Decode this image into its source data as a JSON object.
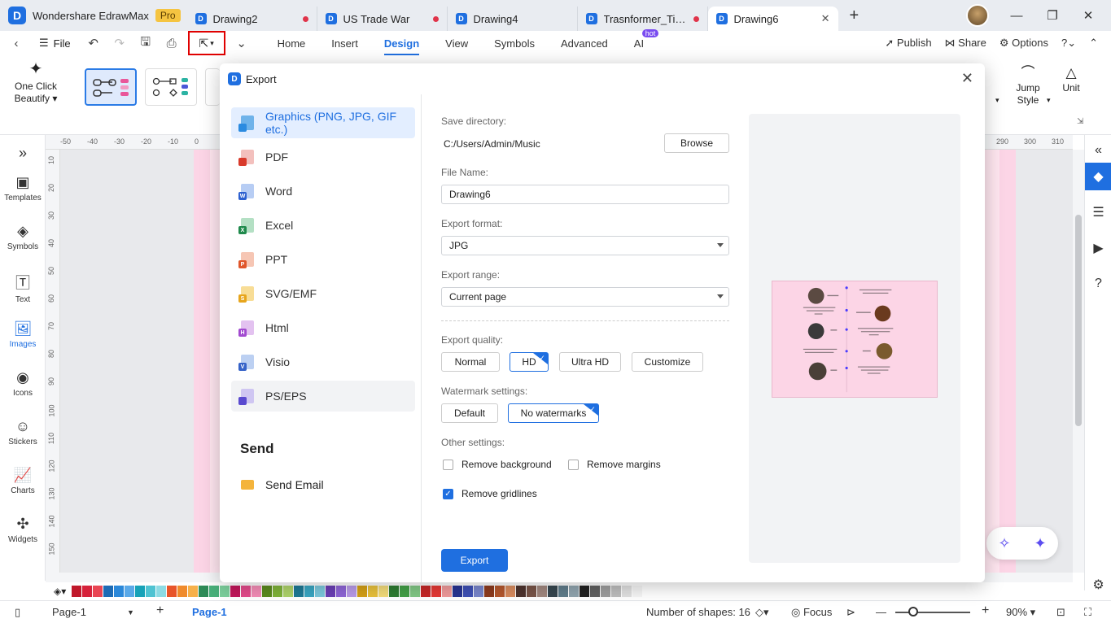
{
  "titlebar": {
    "app_name": "Wondershare EdrawMax",
    "pro_badge": "Pro",
    "tabs": [
      {
        "label": "Drawing2",
        "unsaved": true
      },
      {
        "label": "US Trade War",
        "unsaved": true
      },
      {
        "label": "Drawing4",
        "unsaved": false
      },
      {
        "label": "Trasnformer_Time...",
        "unsaved": true
      },
      {
        "label": "Drawing6",
        "active": true
      }
    ]
  },
  "menubar": {
    "file_label": "File",
    "tabs": [
      "Home",
      "Insert",
      "Design",
      "View",
      "Symbols",
      "Advanced",
      "AI"
    ],
    "active_tab": "Design",
    "ai_badge": "hot",
    "publish": "Publish",
    "share": "Share",
    "options": "Options"
  },
  "ribbon": {
    "one_click_beautify": "One Click Beautify",
    "jump_style": "Jump Style",
    "unit": "Unit"
  },
  "leftbar": {
    "items": [
      "Templates",
      "Symbols",
      "Text",
      "Images",
      "Icons",
      "Stickers",
      "Charts",
      "Widgets"
    ],
    "active": "Images"
  },
  "rulers": {
    "h_ticks": [
      "-50",
      "-40",
      "-30",
      "-20",
      "-10",
      "0",
      "290",
      "300",
      "310"
    ],
    "v_ticks": [
      "10",
      "20",
      "30",
      "40",
      "50",
      "60",
      "70",
      "80",
      "90",
      "100",
      "110",
      "120",
      "130",
      "140",
      "150"
    ]
  },
  "dialog": {
    "title": "Export",
    "formats": [
      "Graphics (PNG, JPG, GIF etc.)",
      "PDF",
      "Word",
      "Excel",
      "PPT",
      "SVG/EMF",
      "Html",
      "Visio",
      "PS/EPS"
    ],
    "active_format": "Graphics (PNG, JPG, GIF etc.)",
    "send_title": "Send",
    "send_email": "Send Email",
    "save_directory_label": "Save directory:",
    "save_directory": "C:/Users/Admin/Music",
    "browse": "Browse",
    "file_name_label": "File Name:",
    "file_name": "Drawing6",
    "export_format_label": "Export format:",
    "export_format": "JPG",
    "export_range_label": "Export range:",
    "export_range": "Current page",
    "quality_label": "Export quality:",
    "quality_options": [
      "Normal",
      "HD",
      "Ultra HD",
      "Customize"
    ],
    "quality_selected": "HD",
    "watermark_label": "Watermark settings:",
    "watermark_options": [
      "Default",
      "No watermarks"
    ],
    "watermark_selected": "No watermarks",
    "other_label": "Other settings:",
    "remove_background": "Remove background",
    "remove_background_checked": false,
    "remove_margins": "Remove margins",
    "remove_margins_checked": false,
    "remove_gridlines": "Remove gridlines",
    "remove_gridlines_checked": true,
    "export_button": "Export"
  },
  "statusbar": {
    "page_select": "Page-1",
    "page_tab": "Page-1",
    "shapes": "Number of shapes: 16",
    "focus": "Focus",
    "zoom": "90%"
  },
  "colors": {
    "accent": "#1f6fe0",
    "page_bg": "#fcd5e6",
    "highlight_box": "#e00000",
    "palette": [
      "#c0182a",
      "#d6223a",
      "#e94553",
      "#1d6bb5",
      "#2b88d9",
      "#5aa9e8",
      "#17a2b8",
      "#4fc3d2",
      "#8ddbe4",
      "#e8552a",
      "#f08b2c",
      "#f6b04a",
      "#2e8b57",
      "#48b07a",
      "#7ccf9c",
      "#c2185b",
      "#e34c8b",
      "#f38db6",
      "#5a8a1e",
      "#7fb33a",
      "#aed36a",
      "#1e7a96",
      "#3aa6c2",
      "#7cc8dc",
      "#6a3fb5",
      "#8e65d6",
      "#b99be8",
      "#d4a017",
      "#e8c13c",
      "#f3dc7a",
      "#2e7d32",
      "#43a047",
      "#81c784",
      "#c62828",
      "#e53935",
      "#ef9a9a",
      "#283593",
      "#3f51b5",
      "#7986cb",
      "#8d3b1e",
      "#b5582e",
      "#d98c5f",
      "#4e342e",
      "#795548",
      "#a1887f",
      "#37474f",
      "#607d8b",
      "#90a4ae",
      "#212121",
      "#616161",
      "#9e9e9e",
      "#bdbdbd",
      "#e0e0e0",
      "#f5f5f5"
    ]
  }
}
